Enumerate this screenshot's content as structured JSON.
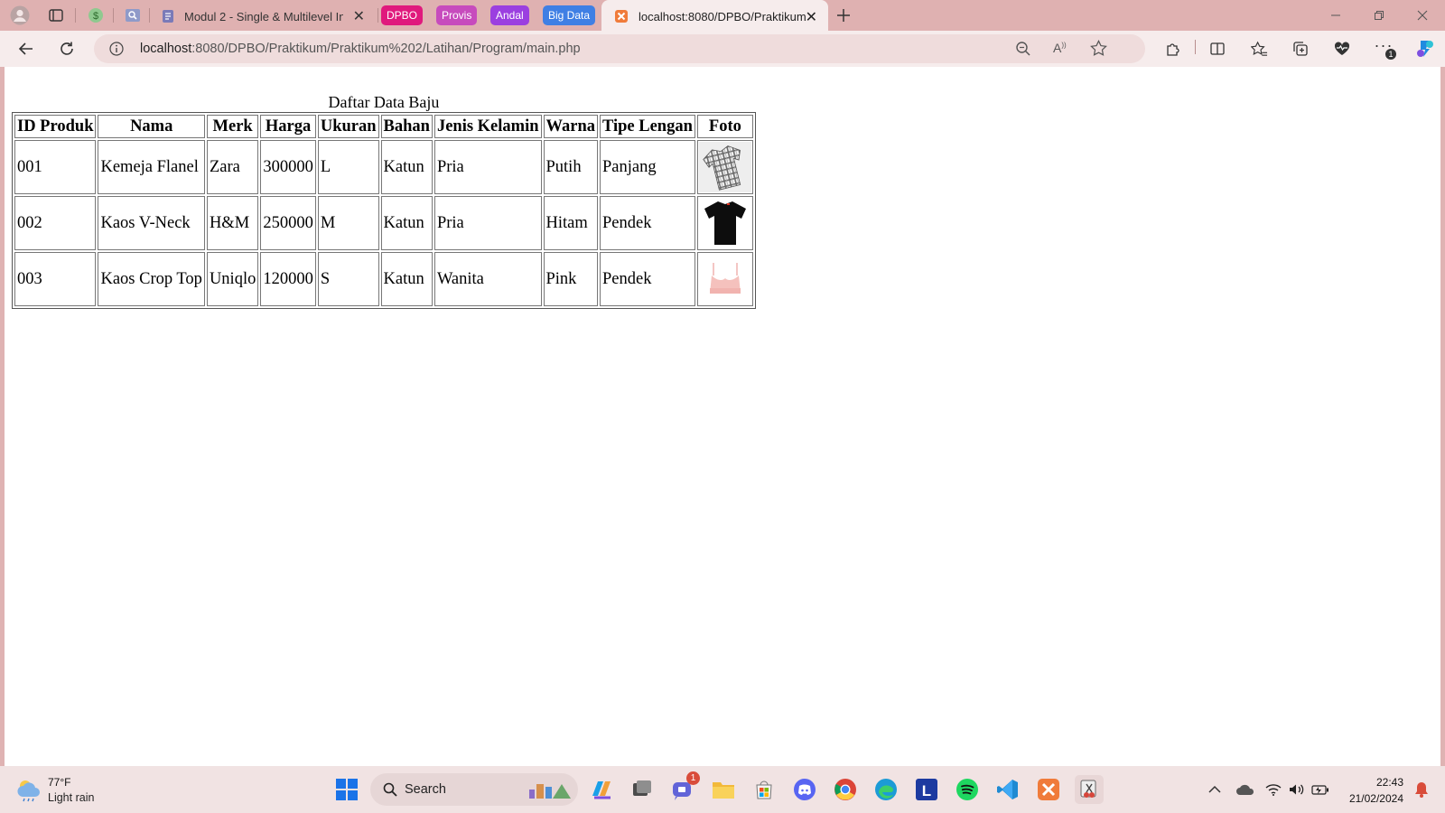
{
  "browser": {
    "tabs": [
      {
        "label": "Modul 2 - Single & Multilevel In"
      },
      {
        "label": "localhost:8080/DPBO/Praktikum/"
      }
    ],
    "tab_groups": [
      {
        "label": "DPBO",
        "color": "#e0197d"
      },
      {
        "label": "Provis",
        "color": "#c74bbd"
      },
      {
        "label": "Andal",
        "color": "#9b3fe0"
      },
      {
        "label": "Big Data",
        "color": "#3f7fe4"
      }
    ],
    "address": {
      "host": "localhost",
      "path": ":8080/DPBO/Praktikum/Praktikum%202/Latihan/Program/main.php"
    },
    "notification_count": "1"
  },
  "page": {
    "caption": "Daftar Data Baju",
    "headers": [
      "ID Produk",
      "Nama",
      "Merk",
      "Harga",
      "Ukuran",
      "Bahan",
      "Jenis Kelamin",
      "Warna",
      "Tipe Lengan",
      "Foto"
    ],
    "rows": [
      {
        "id": "001",
        "nama": "Kemeja Flanel",
        "merk": "Zara",
        "harga": "300000",
        "ukuran": "L",
        "bahan": "Katun",
        "jenis_kelamin": "Pria",
        "warna": "Putih",
        "tipe_lengan": "Panjang",
        "foto": "plaid-shirt"
      },
      {
        "id": "002",
        "nama": "Kaos V-Neck",
        "merk": "H&M",
        "harga": "250000",
        "ukuran": "M",
        "bahan": "Katun",
        "jenis_kelamin": "Pria",
        "warna": "Hitam",
        "tipe_lengan": "Pendek",
        "foto": "black-tshirt"
      },
      {
        "id": "003",
        "nama": "Kaos Crop Top",
        "merk": "Uniqlo",
        "harga": "120000",
        "ukuran": "S",
        "bahan": "Katun",
        "jenis_kelamin": "Wanita",
        "warna": "Pink",
        "tipe_lengan": "Pendek",
        "foto": "pink-crop-top"
      }
    ]
  },
  "taskbar": {
    "weather": {
      "temp": "77°F",
      "desc": "Light rain"
    },
    "search_label": "Search",
    "clock": {
      "time": "22:43",
      "date": "21/02/2024"
    },
    "chat_badge": "1"
  }
}
